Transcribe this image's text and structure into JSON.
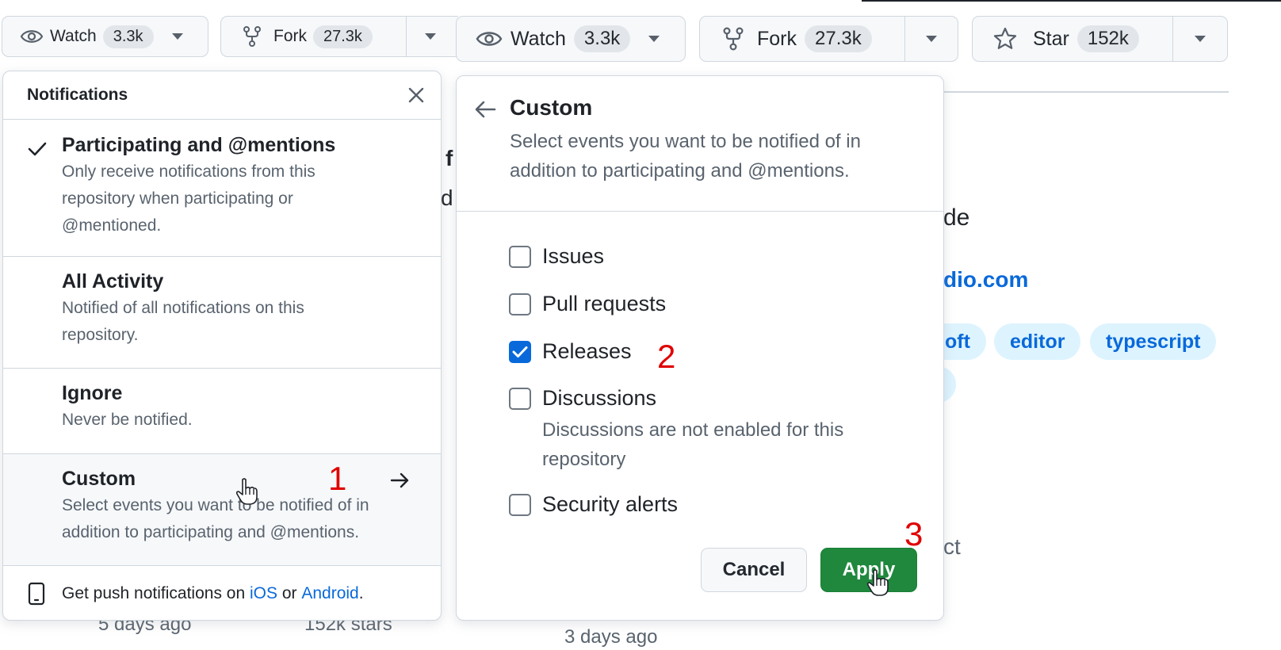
{
  "watch_button_small": {
    "label": "Watch",
    "count": "3.3k"
  },
  "fork_button_small": {
    "label": "Fork",
    "count": "27.3k"
  },
  "watch_button": {
    "label": "Watch",
    "count": "3.3k"
  },
  "fork_button": {
    "label": "Fork",
    "count": "27.3k"
  },
  "star_button": {
    "label": "Star",
    "count": "152k"
  },
  "notifications": {
    "title": "Notifications",
    "options": [
      {
        "title": "Participating and @mentions",
        "desc": "Only receive notifications from this repository when participating or @mentioned.",
        "selected": true
      },
      {
        "title": "All Activity",
        "desc": "Notified of all notifications on this repository.",
        "selected": false
      },
      {
        "title": "Ignore",
        "desc": "Never be notified.",
        "selected": false
      },
      {
        "title": "Custom",
        "desc": "Select events you want to be notified of in addition to participating and @mentions.",
        "selected": false
      }
    ],
    "footer": {
      "prefix": "Get push notifications on ",
      "ios": "iOS",
      "or": " or ",
      "android": "Android",
      "suffix": "."
    }
  },
  "custom": {
    "title": "Custom",
    "desc": "Select events you want to be notified of in addition to participating and @mentions.",
    "events": [
      {
        "label": "Issues",
        "checked": false
      },
      {
        "label": "Pull requests",
        "checked": false
      },
      {
        "label": "Releases",
        "checked": true
      },
      {
        "label": "Discussions",
        "checked": false,
        "note": "Discussions are not enabled for this repository"
      },
      {
        "label": "Security alerts",
        "checked": false
      }
    ],
    "cancel_label": "Cancel",
    "apply_label": "Apply"
  },
  "background": {
    "frag_de": "de",
    "frag_link": "dio.com",
    "frag_ct": "ct",
    "frag_f": "f",
    "frag_d": "d",
    "frag_days_left": "5 days ago",
    "frag_stars": "152k stars",
    "frag_days_right": "3 days ago",
    "topics": [
      "oft",
      "editor",
      "typescript"
    ]
  },
  "annotations": [
    "1",
    "2",
    "3"
  ],
  "colors": {
    "accent": "#0969da",
    "apply_green": "#1f883d",
    "annotation_red": "#e00000"
  }
}
